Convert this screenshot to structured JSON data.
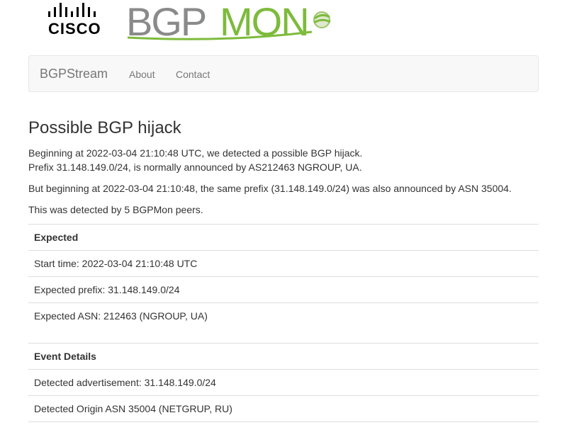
{
  "logos": {
    "cisco_text": "CISCO",
    "bgpmon_text": "BGPMON"
  },
  "navbar": {
    "brand": "BGPStream",
    "about": "About",
    "contact": "Contact"
  },
  "page": {
    "title": "Possible BGP hijack",
    "line1": "Beginning at 2022-03-04 21:10:48 UTC, we detected a possible BGP hijack.",
    "line2": "Prefix 31.148.149.0/24, is normally announced by AS212463 NGROUP, UA.",
    "line3": "But beginning at 2022-03-04 21:10:48, the same prefix (31.148.149.0/24) was also announced by ASN 35004.",
    "line4": "This was detected by 5 BGPMon peers."
  },
  "expected_table": {
    "header": "Expected",
    "rows": [
      "Start time: 2022-03-04 21:10:48 UTC",
      "Expected prefix: 31.148.149.0/24",
      "Expected ASN: 212463 (NGROUP, UA)"
    ]
  },
  "event_table": {
    "header": "Event Details",
    "rows": [
      "Detected advertisement: 31.148.149.0/24",
      "Detected Origin ASN 35004 (NETGRUP, RU)"
    ]
  },
  "colors": {
    "bgpmon_gray": "#8a8a8a",
    "bgpmon_green": "#7dbb3c",
    "nav_bg": "#f8f8f8",
    "nav_text": "#777777"
  }
}
